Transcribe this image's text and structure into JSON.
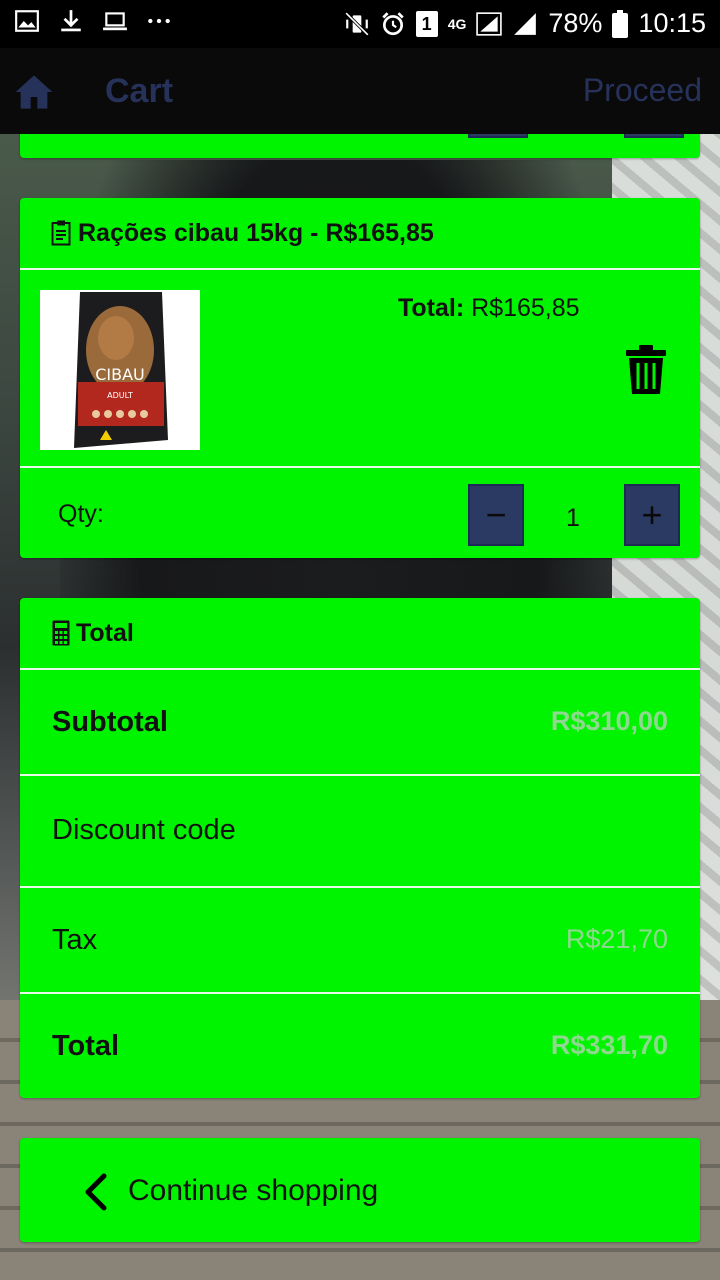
{
  "status_bar": {
    "battery": "78%",
    "time": "10:15",
    "notification_count": "1",
    "network": "4G",
    "left_icons": [
      "image-icon",
      "download-icon",
      "laptop-icon",
      "more-icon"
    ],
    "right_icons": [
      "mute-vibrate-icon",
      "alarm-icon",
      "sim-icon",
      "signal-icon",
      "battery-icon"
    ]
  },
  "appbar": {
    "title": "Cart",
    "proceed_label": "Proceed",
    "home_icon": "home-icon"
  },
  "item": {
    "heading": "Rações cibau 15kg - R$165,85",
    "total_label": "Total:",
    "total_value": "R$165,85",
    "image_brand": "CIBAU",
    "image_variant": "ADULT",
    "qty_label": "Qty:",
    "qty_value": "1",
    "minus_symbol": "−",
    "plus_symbol": "+"
  },
  "totals": {
    "heading": "Total",
    "subtotal_label": "Subtotal",
    "subtotal_value": "R$310,00",
    "discount_label": "Discount code",
    "tax_label": "Tax",
    "tax_value": "R$21,70",
    "total_label": "Total",
    "total_value": "R$331,70"
  },
  "continue": {
    "label": "Continue shopping"
  },
  "colors": {
    "card_green": "#00f400",
    "button_navy": "#2b3a63",
    "appbar_bg": "#0a0a0a",
    "muted_value": "#8fd88f"
  }
}
